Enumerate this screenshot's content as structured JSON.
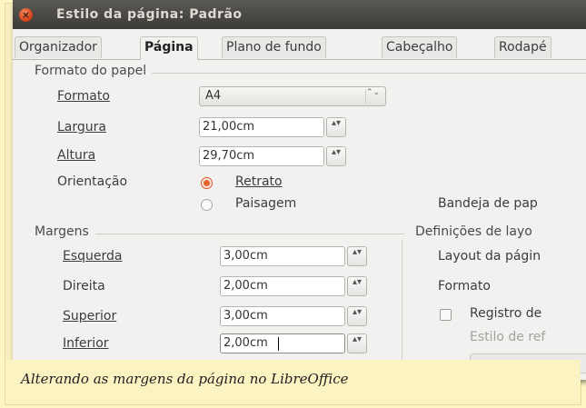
{
  "window": {
    "title": "Estilo da página: Padrão",
    "close_glyph": "×"
  },
  "tabs": [
    {
      "label": "Organizador",
      "active": false
    },
    {
      "label": "Página",
      "active": true
    },
    {
      "label": "Plano de fundo",
      "active": false
    },
    {
      "label": "Cabeçalho",
      "active": false
    },
    {
      "label": "Rodapé",
      "active": false
    }
  ],
  "paper": {
    "section": "Formato do papel",
    "format_label": "Formato",
    "format_value": "A4",
    "width_label": "Largura",
    "width_value": "21,00cm",
    "height_label": "Altura",
    "height_value": "29,70cm",
    "orientation_label": "Orientação",
    "portrait_label": "Retrato",
    "landscape_label": "Paisagem",
    "orientation_selected": "Retrato",
    "tray_label": "Bandeja de pap"
  },
  "margins": {
    "section": "Margens",
    "left_label": "Esquerda",
    "left_value": "3,00cm",
    "right_label": "Direita",
    "right_value": "2,00cm",
    "top_label": "Superior",
    "top_value": "3,00cm",
    "bottom_label": "Inferior",
    "bottom_value": "2,00cm"
  },
  "layout": {
    "section": "Definições de layo",
    "page_layout_label": "Layout da págin",
    "format_label": "Formato",
    "register_label": "Registro de",
    "ref_style_label": "Estilo de ref"
  },
  "spin_glyph": "▴▾",
  "combo_glyph": "⌃⌄",
  "caption": "Alterando as margens da página no LibreOffice",
  "colors": {
    "caption_bg": "#fbf3c2",
    "accent_radio": "#e4622c",
    "titlebar": "#3c3b37"
  }
}
